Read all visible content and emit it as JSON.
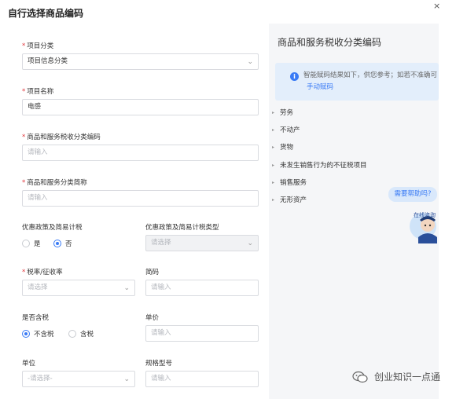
{
  "dialog": {
    "title": "自行选择商品编码",
    "close_glyph": "×"
  },
  "form": {
    "category": {
      "label": "项目分类",
      "value": "项目信息分类"
    },
    "name": {
      "label": "项目名称",
      "value": "电感"
    },
    "tax_code": {
      "label": "商品和服务税收分类编码",
      "placeholder": "请输入"
    },
    "short_name": {
      "label": "商品和服务分类简称",
      "placeholder": "请输入"
    },
    "preferential": {
      "label": "优惠政策及简易计税",
      "options": [
        "是",
        "否"
      ],
      "selected": "否"
    },
    "preferential_type": {
      "label": "优惠政策及简易计税类型",
      "placeholder": "请选择"
    },
    "tax_rate": {
      "label": "税率/征收率",
      "placeholder": "请选择"
    },
    "code": {
      "label": "简码",
      "placeholder": "请输入"
    },
    "tax_included": {
      "label": "是否含税",
      "options": [
        "不含税",
        "含税"
      ],
      "selected": "不含税"
    },
    "unit_price": {
      "label": "单价",
      "placeholder": "请输入"
    },
    "unit": {
      "label": "单位",
      "placeholder": "-请选择-"
    },
    "spec": {
      "label": "规格型号",
      "placeholder": "请输入"
    }
  },
  "panel": {
    "title": "商品和服务税收分类编码",
    "tip_text": "智能赋码结果如下，供您参考；如若不准确可",
    "tip_link": "手动赋码",
    "categories": [
      "劳务",
      "不动产",
      "货物",
      "未发生销售行为的不征税项目",
      "销售服务",
      "无形资产"
    ],
    "help_label": "需要帮助吗?",
    "mascot_text": "在线咨询"
  },
  "watermark": {
    "text": "创业知识一点通"
  },
  "colors": {
    "accent": "#3a7bf5",
    "required": "#e0393e",
    "panel_bg": "#f5f6f8",
    "tip_bg": "#e3eefb"
  }
}
